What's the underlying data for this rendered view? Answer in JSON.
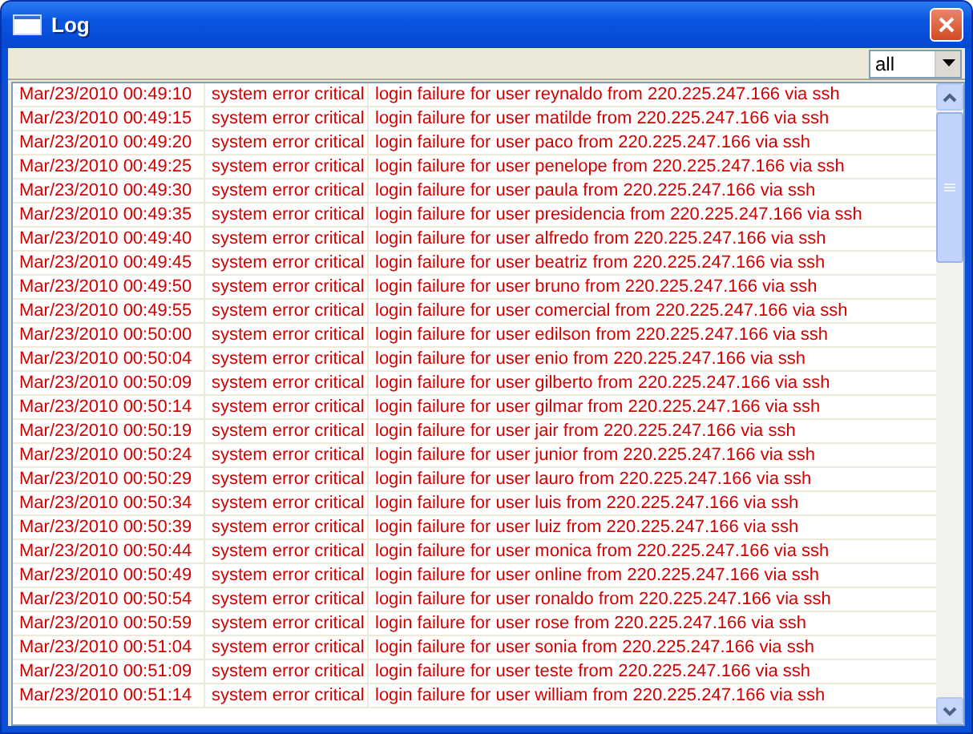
{
  "window": {
    "title": "Log"
  },
  "filter": {
    "value": "all"
  },
  "rows": [
    {
      "time": "Mar/23/2010 00:49:10",
      "topics": "system error critical",
      "message": "login failure for user reynaldo from 220.225.247.166 via ssh"
    },
    {
      "time": "Mar/23/2010 00:49:15",
      "topics": "system error critical",
      "message": "login failure for user matilde from 220.225.247.166 via ssh"
    },
    {
      "time": "Mar/23/2010 00:49:20",
      "topics": "system error critical",
      "message": "login failure for user paco from 220.225.247.166 via ssh"
    },
    {
      "time": "Mar/23/2010 00:49:25",
      "topics": "system error critical",
      "message": "login failure for user penelope from 220.225.247.166 via ssh"
    },
    {
      "time": "Mar/23/2010 00:49:30",
      "topics": "system error critical",
      "message": "login failure for user paula from 220.225.247.166 via ssh"
    },
    {
      "time": "Mar/23/2010 00:49:35",
      "topics": "system error critical",
      "message": "login failure for user presidencia from 220.225.247.166 via ssh"
    },
    {
      "time": "Mar/23/2010 00:49:40",
      "topics": "system error critical",
      "message": "login failure for user alfredo from 220.225.247.166 via ssh"
    },
    {
      "time": "Mar/23/2010 00:49:45",
      "topics": "system error critical",
      "message": "login failure for user beatriz from 220.225.247.166 via ssh"
    },
    {
      "time": "Mar/23/2010 00:49:50",
      "topics": "system error critical",
      "message": "login failure for user bruno from 220.225.247.166 via ssh"
    },
    {
      "time": "Mar/23/2010 00:49:55",
      "topics": "system error critical",
      "message": "login failure for user comercial from 220.225.247.166 via ssh"
    },
    {
      "time": "Mar/23/2010 00:50:00",
      "topics": "system error critical",
      "message": "login failure for user edilson from 220.225.247.166 via ssh"
    },
    {
      "time": "Mar/23/2010 00:50:04",
      "topics": "system error critical",
      "message": "login failure for user enio from 220.225.247.166 via ssh"
    },
    {
      "time": "Mar/23/2010 00:50:09",
      "topics": "system error critical",
      "message": "login failure for user gilberto from 220.225.247.166 via ssh"
    },
    {
      "time": "Mar/23/2010 00:50:14",
      "topics": "system error critical",
      "message": "login failure for user gilmar from 220.225.247.166 via ssh"
    },
    {
      "time": "Mar/23/2010 00:50:19",
      "topics": "system error critical",
      "message": "login failure for user jair from 220.225.247.166 via ssh"
    },
    {
      "time": "Mar/23/2010 00:50:24",
      "topics": "system error critical",
      "message": "login failure for user junior from 220.225.247.166 via ssh"
    },
    {
      "time": "Mar/23/2010 00:50:29",
      "topics": "system error critical",
      "message": "login failure for user lauro from 220.225.247.166 via ssh"
    },
    {
      "time": "Mar/23/2010 00:50:34",
      "topics": "system error critical",
      "message": "login failure for user luis from 220.225.247.166 via ssh"
    },
    {
      "time": "Mar/23/2010 00:50:39",
      "topics": "system error critical",
      "message": "login failure for user luiz from 220.225.247.166 via ssh"
    },
    {
      "time": "Mar/23/2010 00:50:44",
      "topics": "system error critical",
      "message": "login failure for user monica from 220.225.247.166 via ssh"
    },
    {
      "time": "Mar/23/2010 00:50:49",
      "topics": "system error critical",
      "message": "login failure for user online from 220.225.247.166 via ssh"
    },
    {
      "time": "Mar/23/2010 00:50:54",
      "topics": "system error critical",
      "message": "login failure for user ronaldo from 220.225.247.166 via ssh"
    },
    {
      "time": "Mar/23/2010 00:50:59",
      "topics": "system error critical",
      "message": "login failure for user rose from 220.225.247.166 via ssh"
    },
    {
      "time": "Mar/23/2010 00:51:04",
      "topics": "system error critical",
      "message": "login failure for user sonia from 220.225.247.166 via ssh"
    },
    {
      "time": "Mar/23/2010 00:51:09",
      "topics": "system error critical",
      "message": "login failure for user teste from 220.225.247.166 via ssh"
    },
    {
      "time": "Mar/23/2010 00:51:14",
      "topics": "system error critical",
      "message": "login failure for user william from 220.225.247.166 via ssh"
    }
  ]
}
